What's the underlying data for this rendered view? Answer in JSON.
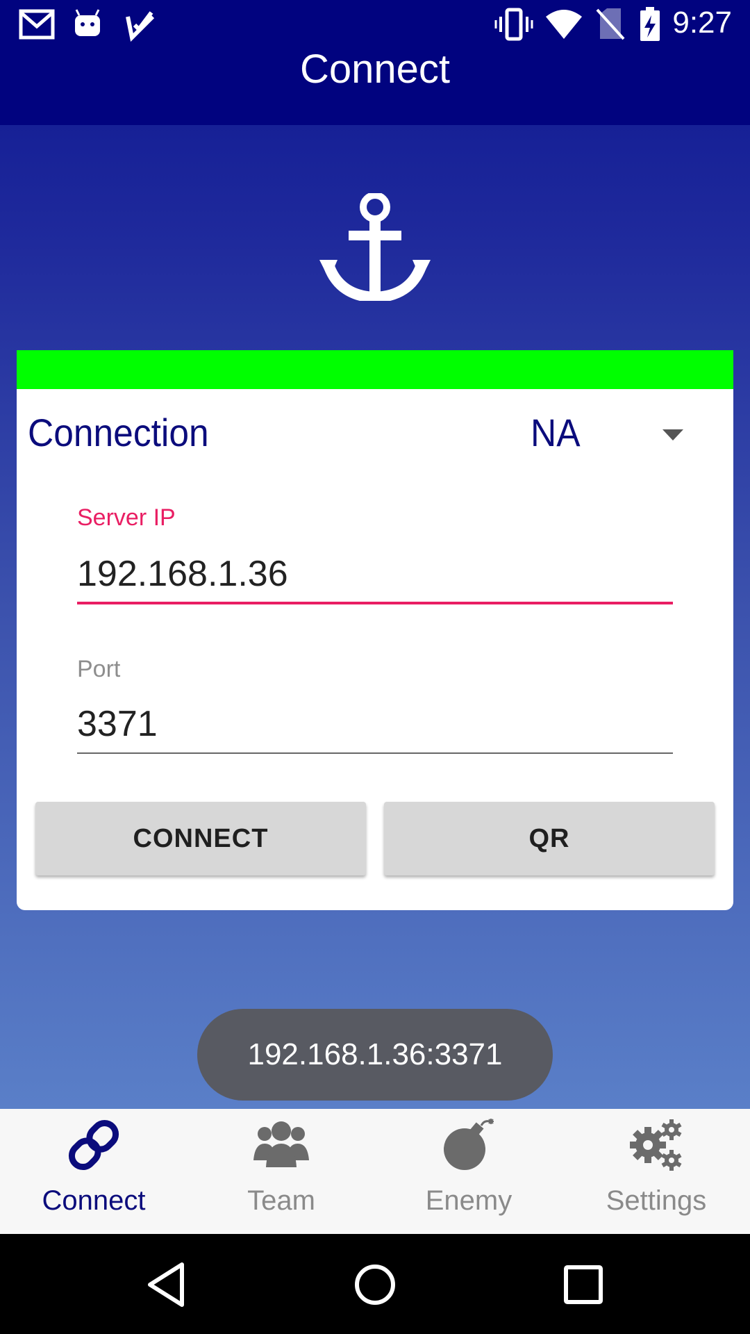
{
  "status_bar": {
    "time": "9:27",
    "left_icons": [
      "gmail-icon",
      "android-icon",
      "task-check-icon"
    ],
    "right_icons": [
      "vibrate-icon",
      "wifi-icon",
      "no-sim-icon",
      "battery-charging-icon"
    ]
  },
  "app_bar": {
    "title": "Connect"
  },
  "colors": {
    "primary": "#01037f",
    "accent": "#e91e63",
    "connection_status": "#00ff00",
    "toast_bg": "#585a62"
  },
  "hero_icon": "anchor-icon",
  "connection_card": {
    "label": "Connection",
    "region_selected": "NA",
    "server_ip": {
      "label": "Server IP",
      "value": "192.168.1.36"
    },
    "port": {
      "label": "Port",
      "value": "3371"
    },
    "connect_button": "CONNECT",
    "qr_button": "QR"
  },
  "toast": {
    "text": "192.168.1.36:3371"
  },
  "bottom_nav": {
    "items": [
      {
        "label": "Connect",
        "icon": "link-icon",
        "active": true
      },
      {
        "label": "Team",
        "icon": "team-icon",
        "active": false
      },
      {
        "label": "Enemy",
        "icon": "bomb-icon",
        "active": false
      },
      {
        "label": "Settings",
        "icon": "gear-icon",
        "active": false
      }
    ]
  },
  "system_nav": {
    "icons": [
      "back-icon",
      "home-icon",
      "recents-icon"
    ]
  }
}
